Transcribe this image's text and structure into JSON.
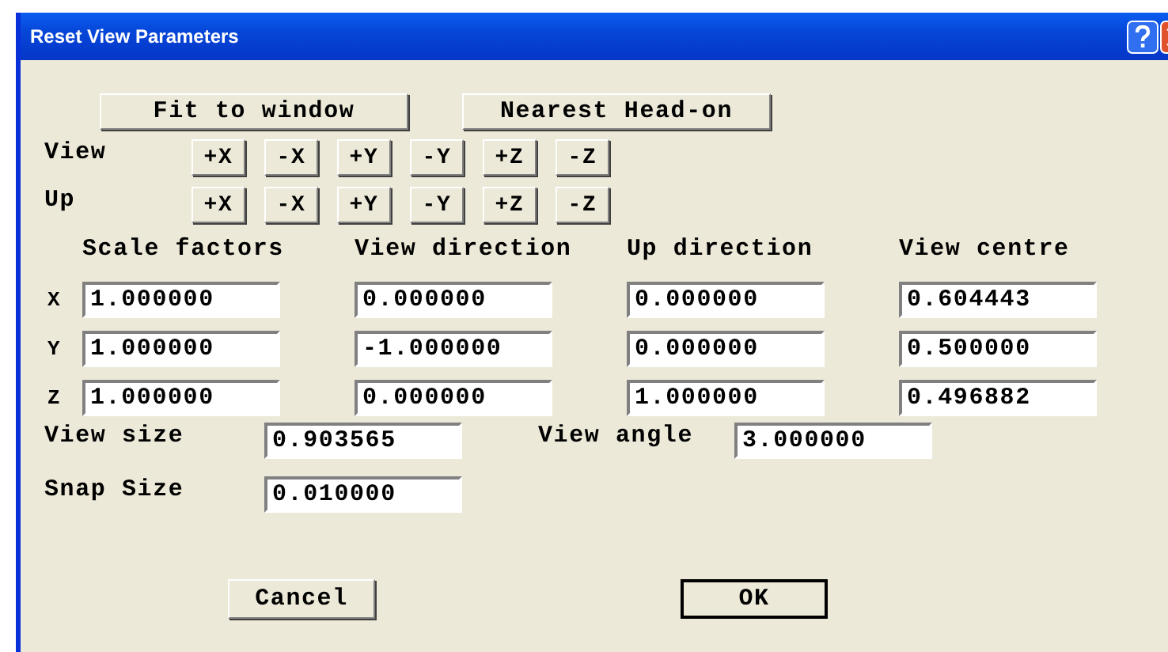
{
  "window": {
    "title": "Reset View Parameters"
  },
  "top_buttons": [
    "Fit to window",
    "Nearest Head-on"
  ],
  "axis_rows": [
    {
      "label": "View",
      "buttons": [
        "+X",
        "-X",
        "+Y",
        "-Y",
        "+Z",
        "-Z"
      ]
    },
    {
      "label": "Up",
      "buttons": [
        "+X",
        "-X",
        "+Y",
        "-Y",
        "+Z",
        "-Z"
      ]
    }
  ],
  "table": {
    "columns": [
      "Scale factors",
      "View direction",
      "Up direction",
      "View centre"
    ],
    "rows": [
      {
        "axis": "X",
        "values": [
          "1.000000",
          "0.000000",
          "0.000000",
          "0.604443"
        ]
      },
      {
        "axis": "Y",
        "values": [
          "1.000000",
          "-1.000000",
          "0.000000",
          "0.500000"
        ]
      },
      {
        "axis": "Z",
        "values": [
          "1.000000",
          "0.000000",
          "1.000000",
          "0.496882"
        ]
      }
    ]
  },
  "fields": [
    {
      "label": "View size",
      "value": "0.903565"
    },
    {
      "label": "View angle",
      "value": "3.000000"
    },
    {
      "label": "Snap Size",
      "value": "0.010000"
    }
  ],
  "buttons": [
    {
      "label": "Cancel",
      "default": false
    },
    {
      "label": "OK",
      "default": true
    }
  ]
}
